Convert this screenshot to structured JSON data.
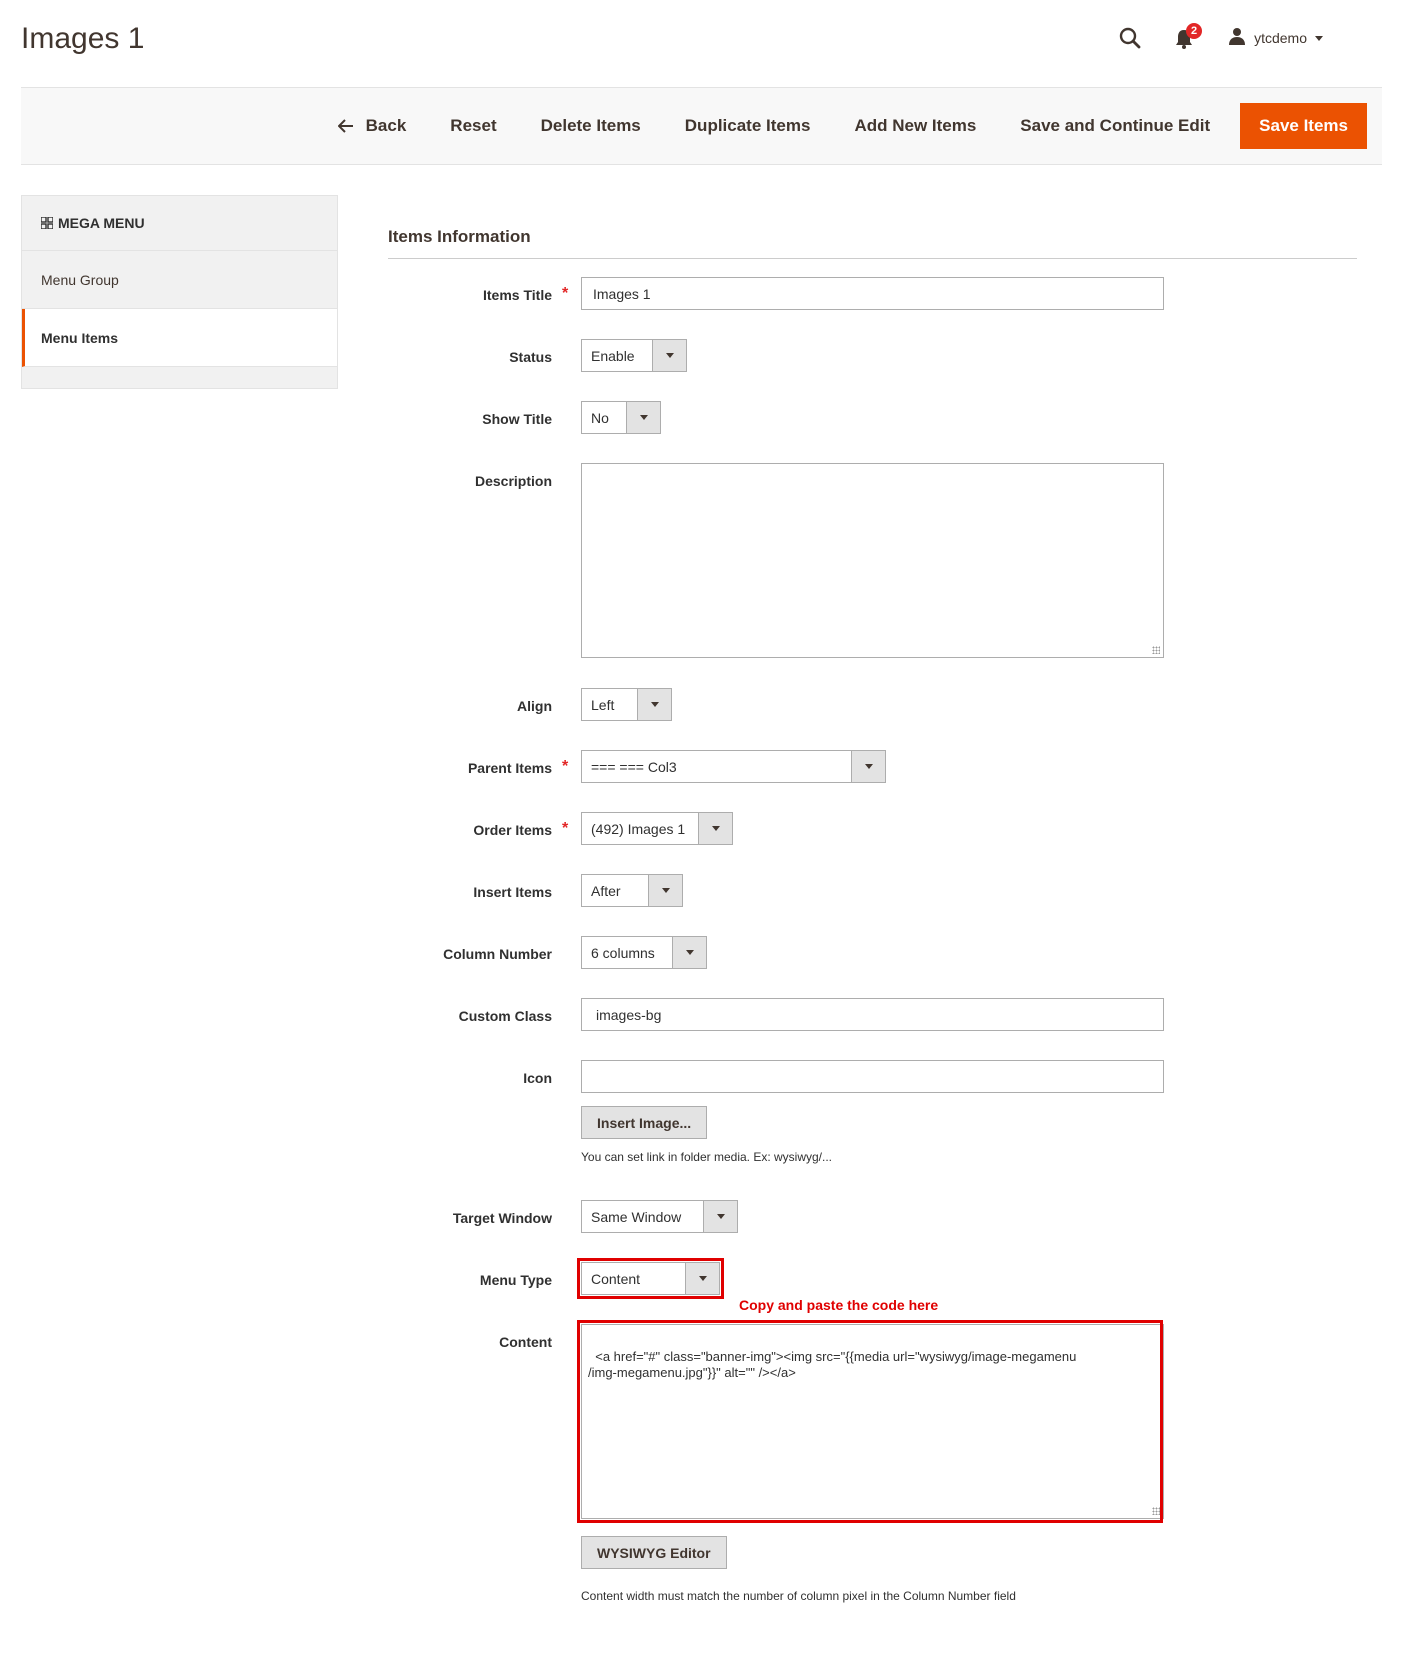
{
  "page": {
    "title": "Images 1"
  },
  "header": {
    "notifications_count": "2",
    "username": "ytcdemo",
    "icons": [
      "search-icon",
      "bell-icon",
      "user-icon",
      "chevron-down-icon"
    ]
  },
  "toolbar": {
    "back_label": "Back",
    "reset_label": "Reset",
    "delete_label": "Delete Items",
    "duplicate_label": "Duplicate Items",
    "add_new_label": "Add New Items",
    "save_continue_label": "Save and Continue Edit",
    "save_label": "Save Items",
    "accent_color": "#eb5202"
  },
  "sidebar": {
    "title": "MEGA MENU",
    "items": [
      {
        "label": "Menu Group"
      },
      {
        "label": "Menu Items"
      }
    ]
  },
  "form": {
    "section_title": "Items Information",
    "items_title": {
      "label": "Items Title",
      "value": "Images 1"
    },
    "status": {
      "label": "Status",
      "value": "Enable"
    },
    "show_title": {
      "label": "Show Title",
      "value": "No"
    },
    "description": {
      "label": "Description",
      "value": ""
    },
    "align": {
      "label": "Align",
      "value": "Left"
    },
    "parent_items": {
      "label": "Parent Items",
      "value": "=== === Col3"
    },
    "order_items": {
      "label": "Order Items",
      "value": "(492) Images 1"
    },
    "insert_items": {
      "label": "Insert Items",
      "value": "After"
    },
    "column_number": {
      "label": "Column Number",
      "value": "6 columns"
    },
    "custom_class": {
      "label": "Custom Class",
      "value": "images-bg"
    },
    "icon": {
      "label": "Icon",
      "value": "",
      "button_label": "Insert Image...",
      "note": "You can set link in folder media. Ex: wysiwyg/..."
    },
    "target_window": {
      "label": "Target Window",
      "value": "Same Window"
    },
    "menu_type": {
      "label": "Menu Type",
      "value": "Content"
    },
    "content": {
      "label": "Content",
      "value": "<a href=\"#\" class=\"banner-img\"><img src=\"{{media url=\"wysiwyg/image-megamenu\n/img-megamenu.jpg\"}}\" alt=\"\" /></a>",
      "button_label": "WYSIWYG Editor",
      "note": "Content width must match the number of column pixel in the Column Number field"
    }
  },
  "annotation": {
    "text": "Copy and paste the code here",
    "color": "#e00000"
  }
}
